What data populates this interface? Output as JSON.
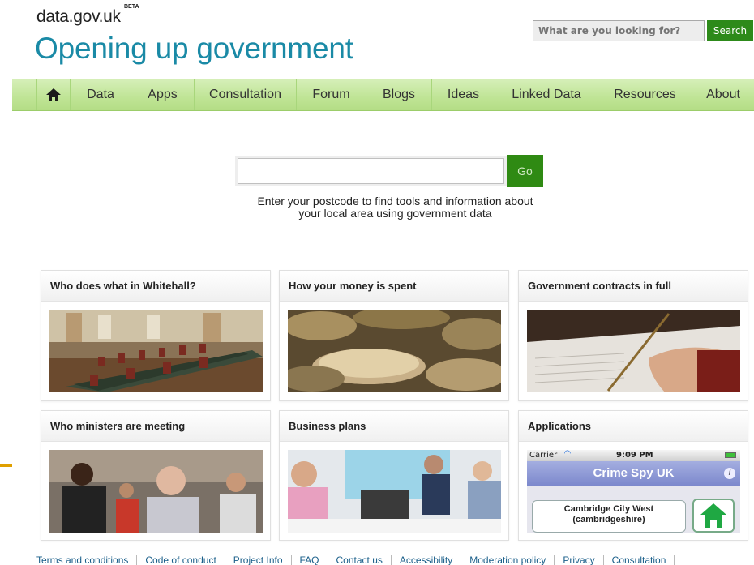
{
  "header": {
    "logo_small": "data.gov.uk",
    "logo_beta": "BETA",
    "logo_big": "Opening up government",
    "search_placeholder": "What are you looking for?",
    "search_button": "Search"
  },
  "nav": {
    "items": [
      "Data",
      "Apps",
      "Consultation",
      "Forum",
      "Blogs",
      "Ideas",
      "Linked Data",
      "Resources",
      "About"
    ]
  },
  "postcode": {
    "button": "Go",
    "help_line1": "Enter your postcode to find tools and information about",
    "help_line2": "your local area using government data"
  },
  "cards": [
    {
      "title": "Who does what in Whitehall?"
    },
    {
      "title": "How your money is spent"
    },
    {
      "title": "Government contracts in full"
    },
    {
      "title": "Who ministers are meeting"
    },
    {
      "title": "Business plans"
    },
    {
      "title": "Applications"
    }
  ],
  "app_preview": {
    "carrier": "Carrier",
    "time": "9:09 PM",
    "title": "Crime Spy UK",
    "location_line1": "Cambridge City West",
    "location_line2": "(cambridgeshire)"
  },
  "footer": {
    "links": [
      "Terms and conditions",
      "Code of conduct",
      "Project Info",
      "FAQ",
      "Contact us",
      "Accessibility",
      "Moderation policy",
      "Privacy",
      "Consultation"
    ]
  },
  "colors": {
    "brand_blue": "#1a8aa6",
    "nav_green": "#bfe495",
    "button_green": "#2d8a1a"
  }
}
